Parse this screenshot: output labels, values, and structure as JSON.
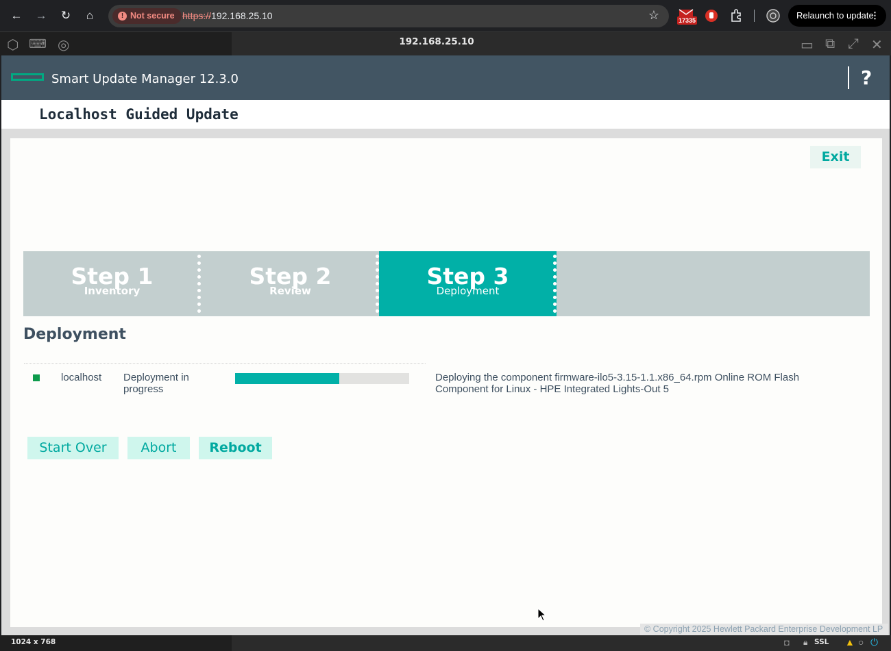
{
  "browser": {
    "security_label": "Not secure",
    "url_scheme": "https://",
    "url_host": "192.168.25.10",
    "extension_badge": "17335",
    "relaunch_label": "Relaunch to update"
  },
  "viewer": {
    "title": "192.168.25.10",
    "resolution": "1024 x 768",
    "ssl_label": "SSL"
  },
  "app": {
    "name": "Smart Update Manager 12.3.0",
    "help_label": "?",
    "page_title": "Localhost Guided Update",
    "exit_label": "Exit",
    "accent_color": "#01b0a7"
  },
  "steps": [
    {
      "title": "Step 1",
      "subtitle": "Inventory",
      "active": false
    },
    {
      "title": "Step 2",
      "subtitle": "Review",
      "active": false
    },
    {
      "title": "Step 3",
      "subtitle": "Deployment",
      "active": true
    }
  ],
  "deployment": {
    "section_title": "Deployment",
    "rows": [
      {
        "host": "localhost",
        "status": "Deployment in progress",
        "status_color": "#0e9b4c",
        "progress": 0.6,
        "message": "Deploying the component firmware-ilo5-3.15-1.1.x86_64.rpm Online ROM Flash Component for Linux - HPE Integrated Lights-Out 5"
      }
    ]
  },
  "actions": {
    "start_over": "Start Over",
    "abort": "Abort",
    "reboot": "Reboot"
  },
  "footer": {
    "copyright": "© Copyright 2025 Hewlett Packard Enterprise Development LP"
  }
}
